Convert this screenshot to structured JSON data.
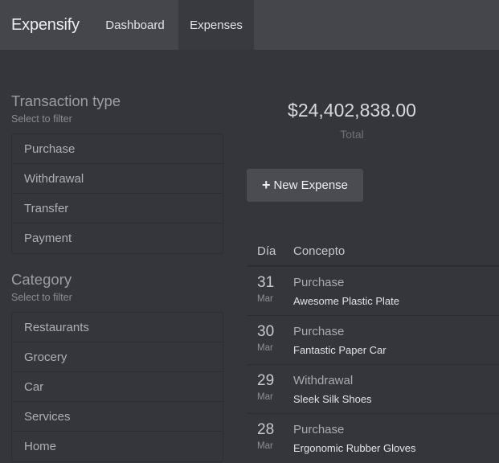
{
  "navbar": {
    "brand": "Expensify",
    "tabs": [
      {
        "label": "Dashboard"
      },
      {
        "label": "Expenses"
      }
    ]
  },
  "filters": {
    "transaction_type": {
      "title": "Transaction type",
      "subtitle": "Select to filter",
      "items": [
        "Purchase",
        "Withdrawal",
        "Transfer",
        "Payment"
      ]
    },
    "category": {
      "title": "Category",
      "subtitle": "Select to filter",
      "items": [
        "Restaurants",
        "Grocery",
        "Car",
        "Services",
        "Home"
      ]
    }
  },
  "summary": {
    "amount": "$24,402,838.00",
    "label": "Total"
  },
  "actions": {
    "new_expense_label": "New Expense",
    "new_expense_icon": "plus-icon"
  },
  "table": {
    "headers": {
      "day": "Día",
      "concept": "Concepto"
    },
    "rows": [
      {
        "day": "31",
        "month": "Mar",
        "type": "Purchase",
        "concept": "Awesome Plastic Plate"
      },
      {
        "day": "30",
        "month": "Mar",
        "type": "Purchase",
        "concept": "Fantastic Paper Car"
      },
      {
        "day": "29",
        "month": "Mar",
        "type": "Withdrawal",
        "concept": "Sleek Silk Shoes"
      },
      {
        "day": "28",
        "month": "Mar",
        "type": "Purchase",
        "concept": "Ergonomic Rubber Gloves"
      }
    ]
  },
  "colors": {
    "background": "#34363c",
    "navbar": "#44464b",
    "active_tab": "#383a3f",
    "button": "#4a4c51"
  }
}
